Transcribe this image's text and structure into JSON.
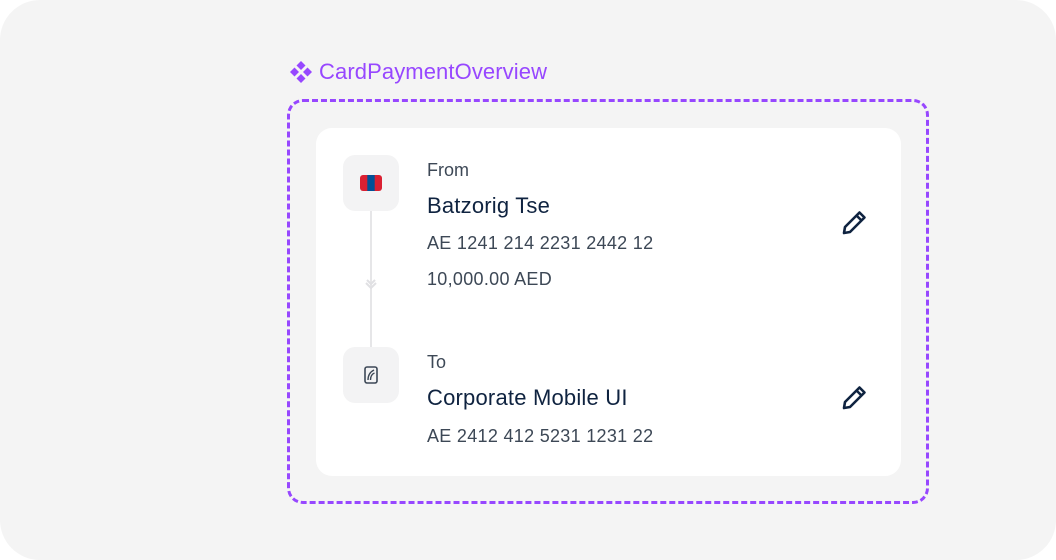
{
  "component": {
    "name": "CardPaymentOverview",
    "accent_color": "#9747ff"
  },
  "from": {
    "caption": "From",
    "name": "Batzorig Tse",
    "account": "AE 1241 214 2231 2442 12",
    "balance": "10,000.00 AED",
    "icon": "mongolia-flag-icon",
    "action_icon": "pencil-icon"
  },
  "to": {
    "caption": "To",
    "name": "Corporate Mobile UI",
    "account": "AE 2412 412 5231 1231 22",
    "icon": "bank-card-icon",
    "action_icon": "pencil-icon"
  },
  "colors": {
    "background": "#f4f4f4",
    "card": "#ffffff",
    "name_text": "#0f2340",
    "secondary_text": "#3d4856"
  }
}
